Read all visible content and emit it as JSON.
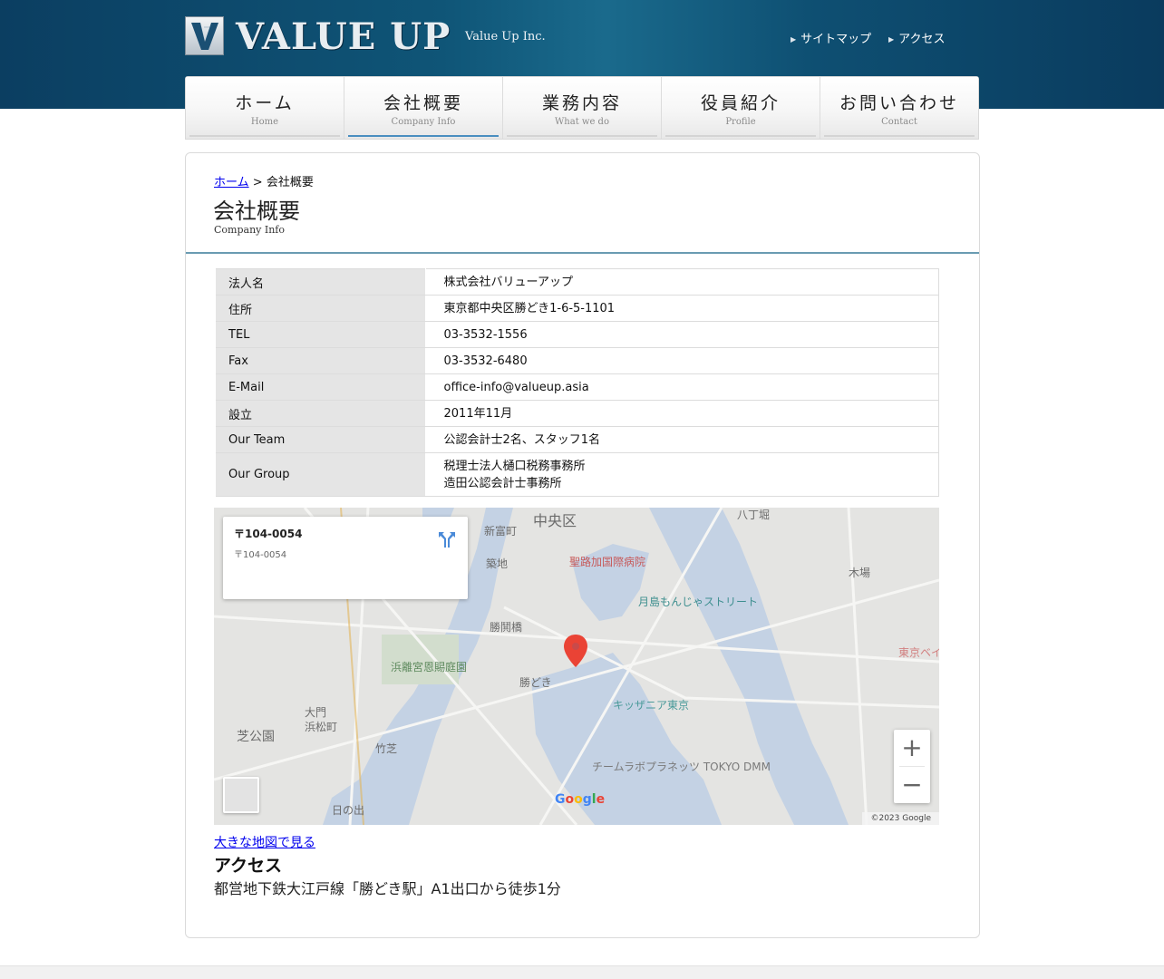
{
  "header": {
    "logo_mark": "V",
    "logo_text": "VALUE UP",
    "logo_sub": "Value Up Inc.",
    "util_links": [
      "サイトマップ",
      "アクセス"
    ]
  },
  "nav": [
    {
      "jp": "ホーム",
      "en": "Home"
    },
    {
      "jp": "会社概要",
      "en": "Company Info"
    },
    {
      "jp": "業務内容",
      "en": "What we do"
    },
    {
      "jp": "役員紹介",
      "en": "Profile"
    },
    {
      "jp": "お問い合わせ",
      "en": "Contact"
    }
  ],
  "breadcrumb": {
    "home": "ホーム",
    "sep": ">",
    "current": "会社概要"
  },
  "page": {
    "title": "会社概要",
    "title_en": "Company Info"
  },
  "company_info": [
    {
      "label": "法人名",
      "value": [
        "株式会社バリューアップ"
      ]
    },
    {
      "label": "住所",
      "value": [
        "東京都中央区勝どき1-6-5-1101"
      ]
    },
    {
      "label": "TEL",
      "value": [
        "03-3532-1556"
      ]
    },
    {
      "label": "Fax",
      "value": [
        "03-3532-6480"
      ]
    },
    {
      "label": "E-Mail",
      "value": [
        "office-info@valueup.asia"
      ]
    },
    {
      "label": "設立",
      "value": [
        "2011年11月"
      ]
    },
    {
      "label": "Our Team",
      "value": [
        "公認会計士2名、スタッフ1名"
      ]
    },
    {
      "label": "Our Group",
      "value": [
        "税理士法人樋口税務事務所",
        "造田公認会計士事務所"
      ]
    }
  ],
  "map": {
    "card_title": "〒104-0054",
    "card_addr": "〒104-0054",
    "labels": [
      "中央区",
      "聖路加国際病院",
      "月島もんじゃストリート",
      "勝どき",
      "キッザニア東京",
      "チームラボプラネッツ TOKYO DMM",
      "浜離宮恩賜庭園",
      "芝公園",
      "大門",
      "浜松町",
      "竹芝",
      "日の出",
      "勝鬨橋",
      "築地",
      "新富町",
      "八丁堀",
      "木場",
      "東京ベイ"
    ],
    "footer": [
      "©2023 Google"
    ],
    "google_letters": [
      "G",
      "o",
      "o",
      "g",
      "l",
      "e"
    ],
    "zoom_in": "+",
    "zoom_out": "−",
    "pin_color": "#ea4335"
  },
  "bigmap_link": "大きな地図で見る",
  "access": {
    "title": "アクセス",
    "text": "都営地下鉄大江戸線「勝どき駅」A1出口から徒歩1分"
  }
}
